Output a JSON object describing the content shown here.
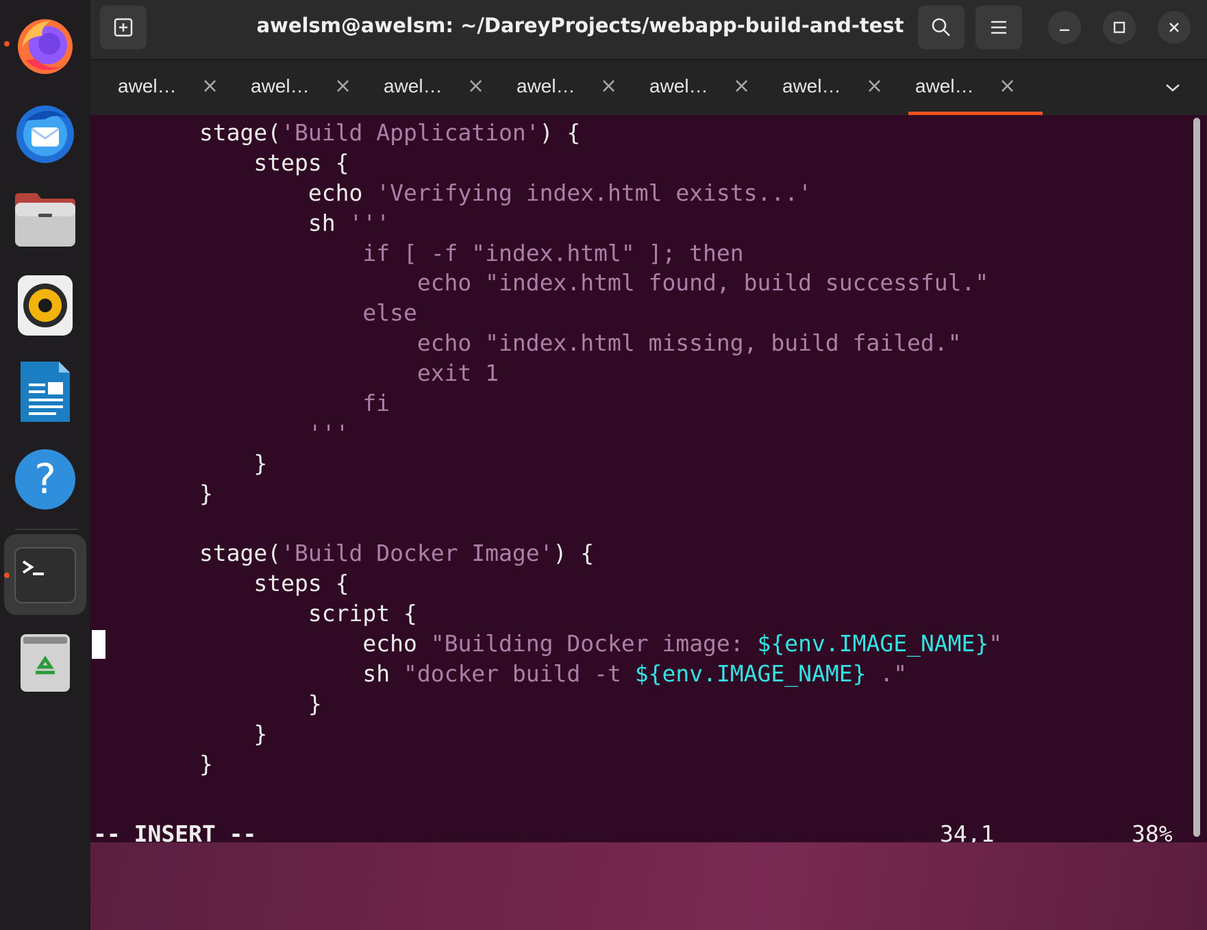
{
  "dock": {
    "items": [
      {
        "name": "firefox-icon",
        "running": true
      },
      {
        "name": "thunderbird-icon",
        "running": false
      },
      {
        "name": "files-icon",
        "running": false
      },
      {
        "name": "rhythmbox-icon",
        "running": false
      },
      {
        "name": "libreoffice-writer-icon",
        "running": false
      },
      {
        "name": "help-icon",
        "running": false
      },
      {
        "name": "terminal-icon",
        "running": true
      },
      {
        "name": "trash-icon",
        "running": false
      }
    ],
    "help_glyph": "?"
  },
  "window": {
    "title": "awelsm@awelsm: ~/DareyProjects/webapp-build-and-test",
    "tabs": [
      {
        "label": "awel…",
        "close": "×",
        "active": false
      },
      {
        "label": "awel…",
        "close": "×",
        "active": false
      },
      {
        "label": "awel…",
        "close": "×",
        "active": false
      },
      {
        "label": "awel…",
        "close": "×",
        "active": false
      },
      {
        "label": "awel…",
        "close": "×",
        "active": false
      },
      {
        "label": "awel…",
        "close": "×",
        "active": false
      },
      {
        "label": "awel…",
        "close": "×",
        "active": true
      }
    ],
    "buttons": {
      "new_tab": "new-tab-icon",
      "search": "search-icon",
      "menu": "hamburger-menu-icon",
      "minimize": "minimize-icon",
      "maximize": "maximize-icon",
      "close": "close-icon",
      "tab_overflow": "chevron-down-icon"
    },
    "accent_color": "#e95420"
  },
  "editor": {
    "colors": {
      "background": "#300a24",
      "text": "#eeeeec",
      "string": "#ad7fa8",
      "variable": "#34e2e2"
    },
    "lines": [
      [
        {
          "t": "        stage(",
          "c": "plain"
        },
        {
          "t": "'Build Application'",
          "c": "str"
        },
        {
          "t": ") {",
          "c": "plain"
        }
      ],
      [
        {
          "t": "            steps {",
          "c": "plain"
        }
      ],
      [
        {
          "t": "                echo ",
          "c": "plain"
        },
        {
          "t": "'Verifying index.html exists...'",
          "c": "str"
        }
      ],
      [
        {
          "t": "                sh ",
          "c": "plain"
        },
        {
          "t": "'''",
          "c": "str"
        }
      ],
      [
        {
          "t": "                    if [ -f \"index.html\" ]; then",
          "c": "str"
        }
      ],
      [
        {
          "t": "                        echo \"index.html found, build successful.\"",
          "c": "str"
        }
      ],
      [
        {
          "t": "                    else",
          "c": "str"
        }
      ],
      [
        {
          "t": "                        echo \"index.html missing, build failed.\"",
          "c": "str"
        }
      ],
      [
        {
          "t": "                        exit 1",
          "c": "str"
        }
      ],
      [
        {
          "t": "                    fi",
          "c": "str"
        }
      ],
      [
        {
          "t": "                '''",
          "c": "str"
        }
      ],
      [
        {
          "t": "            }",
          "c": "plain"
        }
      ],
      [
        {
          "t": "        }",
          "c": "plain"
        }
      ],
      [
        {
          "t": "",
          "c": "plain"
        }
      ],
      [
        {
          "t": "        stage(",
          "c": "plain"
        },
        {
          "t": "'Build Docker Image'",
          "c": "str"
        },
        {
          "t": ") {",
          "c": "plain"
        }
      ],
      [
        {
          "t": "            steps {",
          "c": "plain"
        }
      ],
      [
        {
          "t": "                script {",
          "c": "plain"
        }
      ],
      [
        {
          "t": "                    echo ",
          "c": "plain"
        },
        {
          "t": "\"Building Docker image: ",
          "c": "str"
        },
        {
          "t": "${env.IMAGE_NAME}",
          "c": "var"
        },
        {
          "t": "\"",
          "c": "str"
        }
      ],
      [
        {
          "t": "                    sh ",
          "c": "plain"
        },
        {
          "t": "\"docker build -t ",
          "c": "str"
        },
        {
          "t": "${env.IMAGE_NAME}",
          "c": "var"
        },
        {
          "t": " .\"",
          "c": "str"
        }
      ],
      [
        {
          "t": "                }",
          "c": "plain"
        }
      ],
      [
        {
          "t": "            }",
          "c": "plain"
        }
      ],
      [
        {
          "t": "        }",
          "c": "plain"
        }
      ]
    ],
    "status": {
      "mode": "-- INSERT --",
      "position": "34,1",
      "percent": "38%"
    }
  }
}
